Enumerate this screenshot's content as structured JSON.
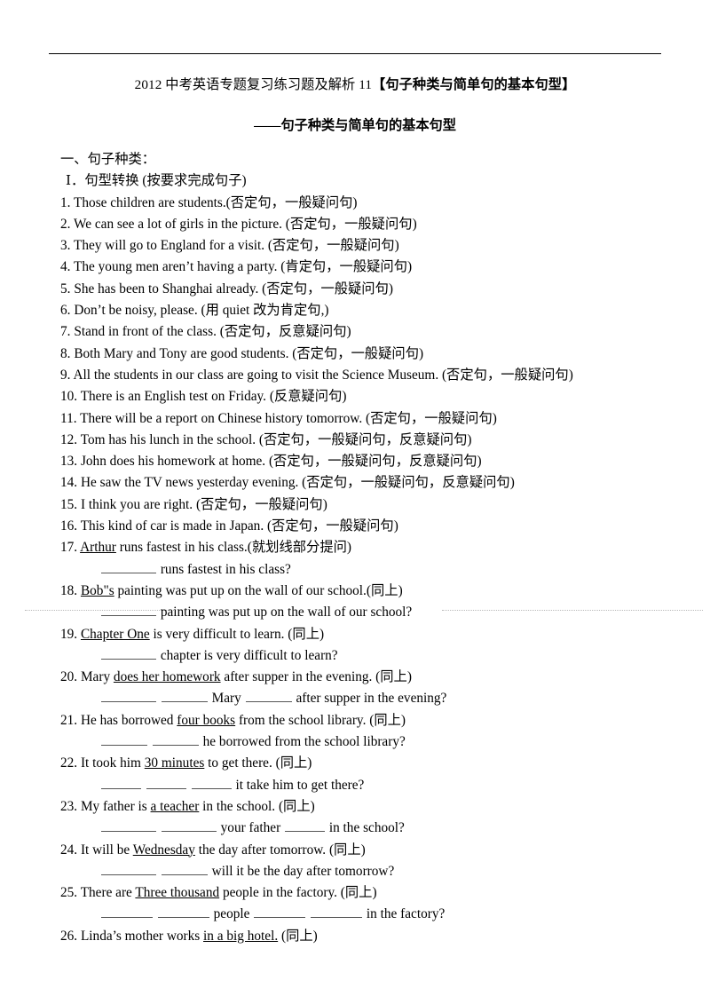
{
  "document": {
    "title_prefix": "2012 中考英语专题复习练习题及解析 11",
    "title_bracket": "【句子种类与简单句的基本句型】",
    "subtitle": "——句子种类与简单句的基本句型",
    "section_heading": "一、句子种类：",
    "roman_heading": "Ⅰ．句型转换 (按要求完成句子)"
  },
  "questions": [
    {
      "num": "1.",
      "text": "Those children are students.(否定句，一般疑问句)"
    },
    {
      "num": "2.",
      "text": "We can see a lot of girls in the picture. (否定句，一般疑问句)"
    },
    {
      "num": "3.",
      "text": "They will go to England for a visit. (否定句，一般疑问句)"
    },
    {
      "num": "4.",
      "text": "The young men aren’t having a party. (肯定句，一般疑问句)"
    },
    {
      "num": "5.",
      "text": "She has been to Shanghai already. (否定句，一般疑问句)"
    },
    {
      "num": "6.",
      "text": "Don’t be noisy, please. (用 quiet 改为肯定句,)"
    },
    {
      "num": "7.",
      "text": "Stand in front of the class. (否定句，反意疑问句)"
    },
    {
      "num": "8.",
      "text": "Both Mary and Tony are good students. (否定句，一般疑问句)"
    },
    {
      "num": "9.",
      "text": "All the students in our class are going to visit the Science Museum. (否定句，一般疑问句)"
    },
    {
      "num": "10.",
      "text": "There is an English test on Friday. (反意疑问句)"
    },
    {
      "num": "11.",
      "text": "There will be a report on Chinese history tomorrow. (否定句，一般疑问句)"
    },
    {
      "num": "12.",
      "text": "Tom has his lunch in the school. (否定句，一般疑问句，反意疑问句)"
    },
    {
      "num": "13.",
      "text": "John does his homework at home. (否定句，一般疑问句，反意疑问句)"
    },
    {
      "num": "14.",
      "text": "He saw the TV news yesterday evening. (否定句，一般疑问句，反意疑问句)"
    },
    {
      "num": "15.",
      "text": "I think you are right. (否定句，一般疑问句)"
    },
    {
      "num": "16.",
      "text": "This kind of car is made in Japan. (否定句，一般疑问句)"
    }
  ],
  "underlined_questions": [
    {
      "num": "17.",
      "underlined": "Arthur",
      "after": " runs fastest in his class.(就划线部分提问)",
      "answer_suffix": " runs fastest in his class?",
      "blanks": 1
    },
    {
      "num": "18.",
      "underlined": "Bob\"s",
      "after": " painting was put up on the wall of our school.(同上)",
      "answer_suffix": " painting was put up on the wall of our school?",
      "blanks": 1
    },
    {
      "num": "19.",
      "underlined": "Chapter One",
      "after": " is very difficult to learn. (同上)",
      "answer_suffix": " chapter is very difficult to learn?",
      "blanks": 1
    },
    {
      "num": "20.",
      "before": "Mary ",
      "underlined": "does her homework",
      "after": "   after supper in the evening. (同上)",
      "answer_parts": [
        "",
        " ",
        " Mary ",
        " after supper in the evening?"
      ],
      "blanks": 3
    },
    {
      "num": "21.",
      "before": "He has borrowed ",
      "underlined": "four books",
      "after": " from the school library. (同上)",
      "answer_parts": [
        "",
        " ",
        " he borrowed from the school library?"
      ],
      "blanks": 2
    },
    {
      "num": "22.",
      "before": "It took him ",
      "underlined": "30 minutes",
      "after": " to get there. (同上)",
      "answer_parts": [
        "",
        " ",
        " ",
        " it take him to get there?"
      ],
      "blanks": 3
    },
    {
      "num": "23.",
      "before": "My father is ",
      "underlined": "a teacher",
      "after": " in the school. (同上)",
      "answer_parts": [
        "",
        " ",
        " your father ",
        " in the school?"
      ],
      "blanks": 3
    },
    {
      "num": "24.",
      "before": "It will be ",
      "underlined": "Wednesday",
      "after": " the day after tomorrow. (同上)",
      "answer_parts": [
        "",
        " ",
        " will it be the day after tomorrow?"
      ],
      "blanks": 2
    },
    {
      "num": "25.",
      "before": "There are ",
      "underlined": "Three thousand",
      "after": " people in the factory. (同上)",
      "answer_parts": [
        "",
        " ",
        " people ",
        " ",
        " in the factory?"
      ],
      "blanks": 4
    },
    {
      "num": "26.",
      "before": "Linda’s mother works ",
      "underlined": "in a big hotel.",
      "after": " (同上)",
      "answer_parts": [],
      "blanks": 0
    }
  ]
}
